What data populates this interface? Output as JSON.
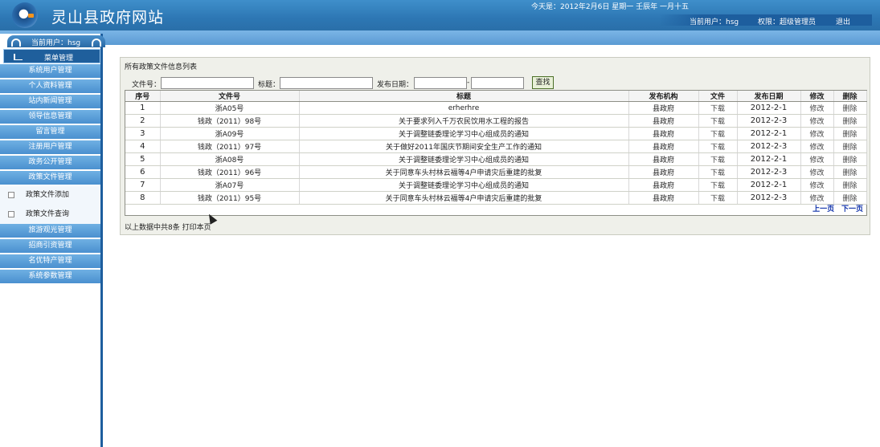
{
  "header": {
    "site_title": "灵山县政府网站",
    "date_text": "今天是：2012年2月6日 星期一 壬辰年 一月十五",
    "current_user": "当前用户：hsg",
    "permission": "权限：超级管理员",
    "logout": "退出"
  },
  "sidebar": {
    "current_user": "当前用户：hsg",
    "menu_title": "菜单管理",
    "items_top": [
      "系统用户管理",
      "个人资料管理",
      "站内新闻管理",
      "领导信息管理",
      "留言管理",
      "注册用户管理",
      "政务公开管理",
      "政策文件管理"
    ],
    "subitems": [
      "政策文件添加",
      "政策文件查询"
    ],
    "items_bottom": [
      "旅游观光管理",
      "招商引资管理",
      "名优特产管理",
      "系统参数管理"
    ]
  },
  "panel": {
    "title": "所有政策文件信息列表",
    "search": {
      "doc_no_label": "文件号：",
      "title_label": "标题：",
      "date_label": "发布日期：",
      "date_sep": "-",
      "button": "查找"
    },
    "table": {
      "headers": [
        "序号",
        "文件号",
        "标题",
        "发布机构",
        "文件",
        "发布日期",
        "修改",
        "删除"
      ],
      "rows": [
        [
          "1",
          "浙A05号",
          "erherhre",
          "县政府",
          "下载",
          "2012-2-1",
          "修改",
          "删除"
        ],
        [
          "2",
          "钱政（2011）98号",
          "关于要求列入千万农民饮用水工程的报告",
          "县政府",
          "下载",
          "2012-2-3",
          "修改",
          "删除"
        ],
        [
          "3",
          "浙A09号",
          "关于调整链委理论学习中心组成员的通知",
          "县政府",
          "下载",
          "2012-2-1",
          "修改",
          "删除"
        ],
        [
          "4",
          "钱政（2011）97号",
          "关于做好2011年国庆节期间安全生产工作的通知",
          "县政府",
          "下载",
          "2012-2-3",
          "修改",
          "删除"
        ],
        [
          "5",
          "浙A08号",
          "关于调整链委理论学习中心组成员的通知",
          "县政府",
          "下载",
          "2012-2-1",
          "修改",
          "删除"
        ],
        [
          "6",
          "钱政（2011）96号",
          "关于同意车头村林云福等4户申请灾后重建的批复",
          "县政府",
          "下载",
          "2012-2-3",
          "修改",
          "删除"
        ],
        [
          "7",
          "浙A07号",
          "关于调整链委理论学习中心组成员的通知",
          "县政府",
          "下载",
          "2012-2-1",
          "修改",
          "删除"
        ],
        [
          "8",
          "钱政（2011）95号",
          "关于同意车头村林云福等4户申请灾后重建的批复",
          "县政府",
          "下载",
          "2012-2-3",
          "修改",
          "删除"
        ]
      ]
    },
    "pager": {
      "prev": "上一页",
      "next": "下一页"
    },
    "footer_summary": "以上数据中共8条",
    "print": "打印本页"
  }
}
